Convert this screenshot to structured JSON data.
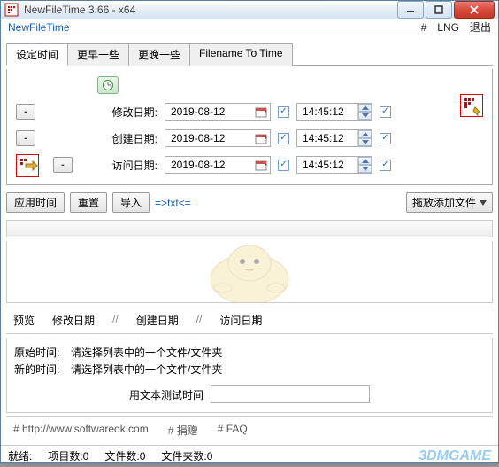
{
  "title": "NewFileTime 3.66 - x64",
  "menubar": {
    "appname": "NewFileTime",
    "hash": "#",
    "lng": "LNG",
    "exit": "退出"
  },
  "tabs": [
    "设定时间",
    "更早一些",
    "更晚一些",
    "Filename To Time"
  ],
  "labels": {
    "modify": "修改日期:",
    "create": "创建日期:",
    "access": "访问日期:"
  },
  "rows": {
    "modify": {
      "date": "2019-08-12",
      "time": "14:45:12",
      "dchk": true,
      "tchk": true
    },
    "create": {
      "date": "2019-08-12",
      "time": "14:45:12",
      "dchk": true,
      "tchk": true
    },
    "access": {
      "date": "2019-08-12",
      "time": "14:45:12",
      "dchk": true,
      "tchk": true
    }
  },
  "toolbar": {
    "apply": "应用时间",
    "reset": "重置",
    "import": "导入",
    "txt": "=>txt<=",
    "dragadd": "拖放添加文件"
  },
  "preview": {
    "label": "预览",
    "modify": "修改日期",
    "create": "创建日期",
    "access": "访问日期",
    "sep": "//"
  },
  "info": {
    "origlabel": "原始时间:",
    "newlabel": "新的时间:",
    "placeholder": "请选择列表中的一个文件/文件夹"
  },
  "test": {
    "label": "用文本测试时间"
  },
  "links": {
    "url": "# http://www.softwareok.com",
    "donate": "# 捐赠",
    "faq": "# FAQ"
  },
  "status": {
    "ready": "就绪:",
    "items": "项目数:0",
    "files": "文件数:0",
    "folders": "文件夹数:0"
  },
  "watermark": "3DMGAME"
}
